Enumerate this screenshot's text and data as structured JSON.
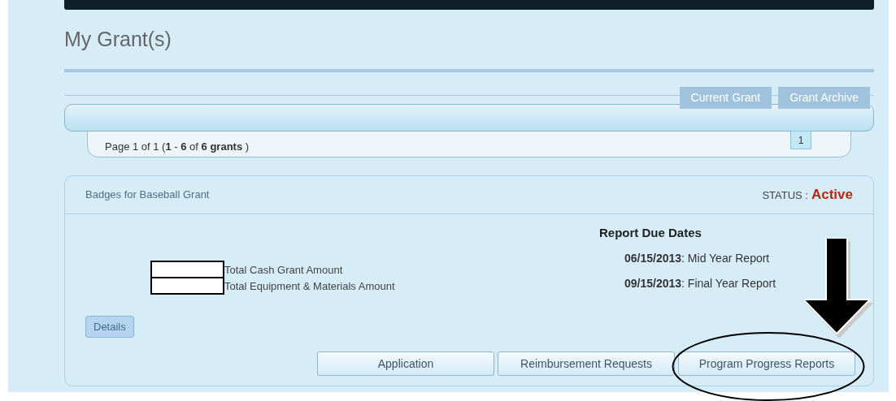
{
  "page_title": "My Grant(s)",
  "tabs": [
    {
      "label": "Current Grant"
    },
    {
      "label": "Grant Archive"
    }
  ],
  "pager": {
    "summary": "Page 1 of 1 (**1** - **6** of **6 grants** )",
    "pages": [
      "1"
    ]
  },
  "grant": {
    "name": "Badges for Baseball Grant",
    "status_label": "STATUS :",
    "status": "Active",
    "amounts": [
      {
        "label": "Total Cash Grant Amount"
      },
      {
        "label": "Total Equipment & Materials Amount"
      }
    ],
    "report_heading": "Report Due Dates",
    "reports": [
      {
        "date": "06/15/2013",
        "name": ": Mid Year Report"
      },
      {
        "date": "09/15/2013",
        "name": ": Final Year Report"
      }
    ],
    "details_button": "Details",
    "actions": [
      "Application",
      "Reimbursement Requests",
      "Program Progress Reports"
    ]
  }
}
